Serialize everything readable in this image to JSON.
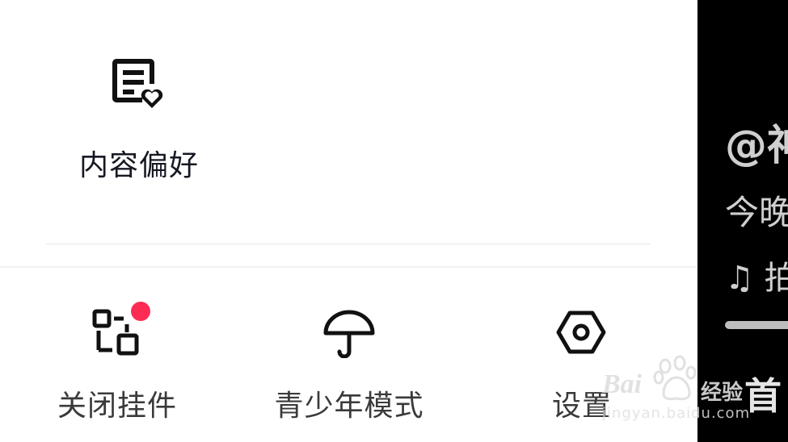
{
  "menu": {
    "content_preferences_label": "内容偏好",
    "close_widget_label": "关闭挂件",
    "teen_mode_label": "青少年模式",
    "settings_label": "设置",
    "notification_color": "#fe2c55"
  },
  "background_video": {
    "author": "@神",
    "caption": "今晚",
    "music": "♫ 拍",
    "home_tab": "首"
  },
  "watermark": {
    "brand": "Bai",
    "brand_suffix": "经验",
    "url": "jingyan.baidu.com"
  },
  "icons": {
    "content_preferences": "document-heart-icon",
    "close_widget": "widget-blocks-icon",
    "teen_mode": "umbrella-icon",
    "settings": "hexagon-gear-icon"
  }
}
